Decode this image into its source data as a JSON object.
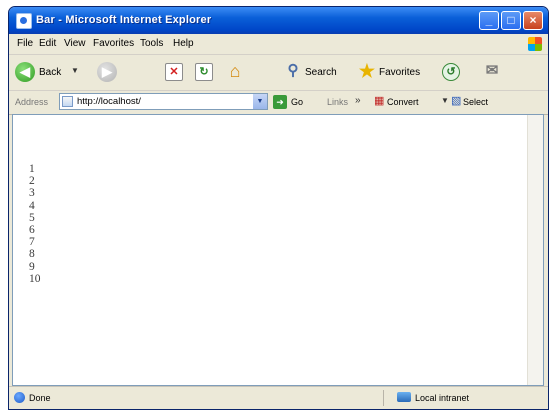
{
  "window": {
    "title": "Bar - Microsoft Internet Explorer"
  },
  "menu": {
    "items": [
      "File",
      "Edit",
      "View",
      "Favorites",
      "Tools",
      "Help"
    ]
  },
  "toolbar": {
    "back_label": "Back",
    "search_label": "Search",
    "favorites_label": "Favorites",
    "icons": [
      "back-arrow",
      "forward-arrow",
      "stop",
      "refresh",
      "home",
      "search",
      "favorites-star",
      "history",
      "mail"
    ]
  },
  "address": {
    "label": "Address",
    "url": "http://localhost/",
    "go_label": "Go",
    "links_label": "Links",
    "convert_label": "Convert",
    "select_label": "Select"
  },
  "content": {
    "lines": [
      "1",
      "2",
      "3",
      "4",
      "5",
      "6",
      "7",
      "8",
      "9",
      "10"
    ]
  },
  "status": {
    "text": "Done",
    "zone": "Local intranet"
  },
  "colors": {
    "titlebar": "#0a5fd8",
    "chrome": "#ece9d8"
  }
}
